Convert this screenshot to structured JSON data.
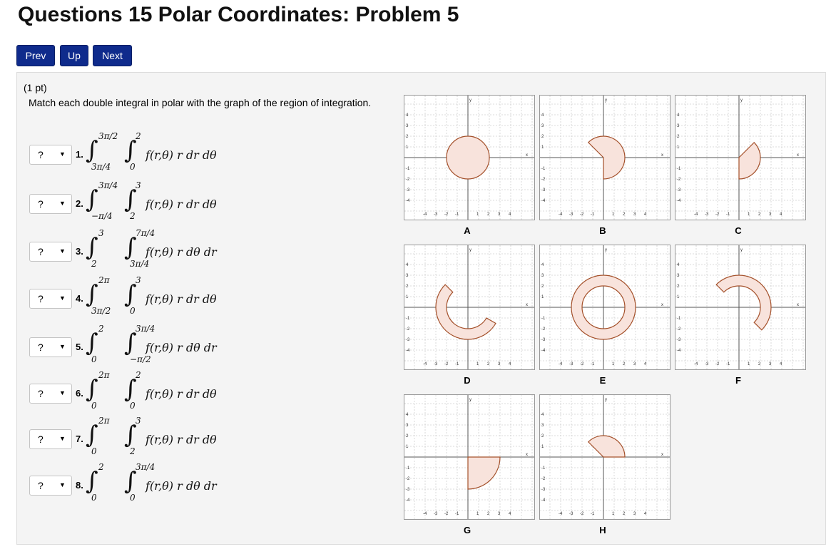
{
  "page": {
    "title": "Questions 15 Polar Coordinates: Problem 5"
  },
  "nav": {
    "prev": "Prev",
    "up": "Up",
    "next": "Next"
  },
  "problem": {
    "points": "(1 pt)",
    "instructions": "Match each double integral in polar with the graph of the region of integration."
  },
  "select_placeholder": "?",
  "select_arrow": "▼",
  "integrals": [
    {
      "num": "1.",
      "outer_upper": "3π/2",
      "outer_lower": "3π/4",
      "inner_upper": "2",
      "inner_lower": "0",
      "integrand": "f(r,θ) r dr dθ"
    },
    {
      "num": "2.",
      "outer_upper": "3π/4",
      "outer_lower": "−π/4",
      "inner_upper": "3",
      "inner_lower": "2",
      "integrand": "f(r,θ) r dr dθ"
    },
    {
      "num": "3.",
      "outer_upper": "3",
      "outer_lower": "2",
      "inner_upper": "7π/4",
      "inner_lower": "3π/4",
      "integrand": "f(r,θ) r dθ dr"
    },
    {
      "num": "4.",
      "outer_upper": "2π",
      "outer_lower": "3π/2",
      "inner_upper": "3",
      "inner_lower": "0",
      "integrand": "f(r,θ) r dr dθ"
    },
    {
      "num": "5.",
      "outer_upper": "2",
      "outer_lower": "0",
      "inner_upper": "3π/4",
      "inner_lower": "−π/2",
      "integrand": "f(r,θ) r dθ dr"
    },
    {
      "num": "6.",
      "outer_upper": "2π",
      "outer_lower": "0",
      "inner_upper": "2",
      "inner_lower": "0",
      "integrand": "f(r,θ) r dr dθ"
    },
    {
      "num": "7.",
      "outer_upper": "2π",
      "outer_lower": "0",
      "inner_upper": "3",
      "inner_lower": "2",
      "integrand": "f(r,θ) r dr dθ"
    },
    {
      "num": "8.",
      "outer_upper": "2",
      "outer_lower": "0",
      "inner_upper": "3π/4",
      "inner_lower": "0",
      "integrand": "f(r,θ) r dθ dr"
    }
  ],
  "graphs": [
    {
      "label": "A",
      "r_min": 0,
      "r_max": 2,
      "theta_start_deg": 0,
      "theta_end_deg": 360
    },
    {
      "label": "B",
      "r_min": 0,
      "r_max": 2,
      "theta_start_deg": -90,
      "theta_end_deg": 135
    },
    {
      "label": "C",
      "r_min": 0,
      "r_max": 2,
      "theta_start_deg": -90,
      "theta_end_deg": 45
    },
    {
      "label": "D",
      "r_min": 2,
      "r_max": 3,
      "theta_start_deg": 135,
      "theta_end_deg": 330
    },
    {
      "label": "E",
      "r_min": 2,
      "r_max": 3,
      "theta_start_deg": 0,
      "theta_end_deg": 360
    },
    {
      "label": "F",
      "r_min": 2,
      "r_max": 3,
      "theta_start_deg": -45,
      "theta_end_deg": 135
    },
    {
      "label": "G",
      "r_min": 0,
      "r_max": 3,
      "theta_start_deg": -90,
      "theta_end_deg": 0
    },
    {
      "label": "H",
      "r_min": 0,
      "r_max": 2,
      "theta_start_deg": 0,
      "theta_end_deg": 135
    }
  ],
  "axis": {
    "x_label": "x",
    "y_label": "y",
    "x_ticks": [
      "-4",
      "-3",
      "-2",
      "-1",
      "1",
      "2",
      "3",
      "4"
    ],
    "y_ticks": [
      "4",
      "3",
      "2",
      "1",
      "-1",
      "-2",
      "-3",
      "-4"
    ],
    "range": [
      -6,
      6
    ]
  },
  "colors": {
    "region_fill": "#f8e3dc",
    "region_stroke": "#a4502a",
    "nav_button": "#0f2b8c"
  }
}
